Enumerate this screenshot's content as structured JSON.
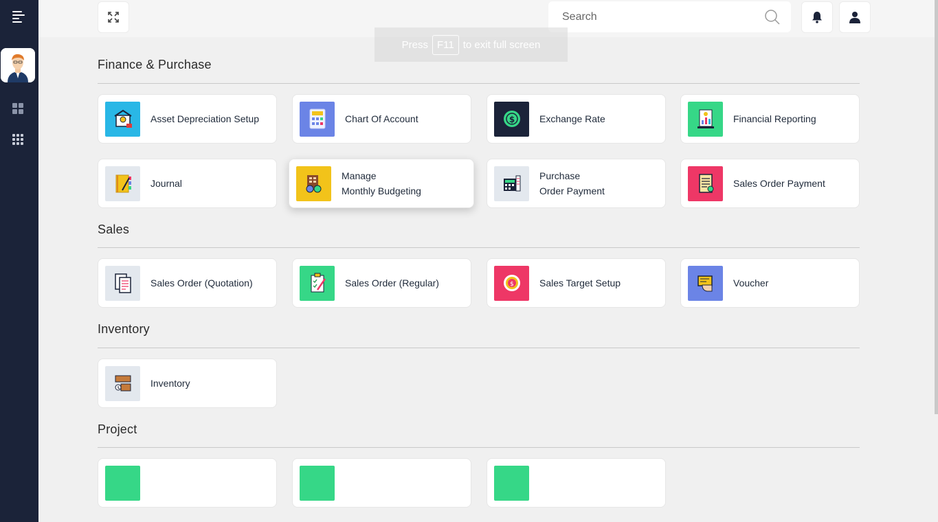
{
  "search": {
    "placeholder": "Search"
  },
  "toast": {
    "pre": "Press",
    "key": "F11",
    "post": "to exit full screen"
  },
  "colors": {
    "sidebar": "#1b2339",
    "green": "#36d787",
    "blue": "#6b84e6",
    "navy": "#1b2339",
    "yellow": "#f2c31a",
    "pink": "#ee3766",
    "sky": "#29b7e6",
    "gray": "#e3e8ee"
  },
  "sections": {
    "finance": {
      "title": "Finance & Purchase",
      "items": [
        {
          "label": "Asset Depreciation Setup",
          "icon": "building-money-icon",
          "color": "#29b7e6"
        },
        {
          "label": "Chart Of Account",
          "icon": "calculator-chart-icon",
          "color": "#6b84e6"
        },
        {
          "label": "Exchange Rate",
          "icon": "currency-exchange-icon",
          "color": "#1b2339"
        },
        {
          "label": "Financial Reporting",
          "icon": "report-chart-icon",
          "color": "#36d787"
        },
        {
          "label": "Journal",
          "icon": "journal-book-icon",
          "color": "#e3e8ee"
        },
        {
          "label_line1": "Manage",
          "label_line2": "Monthly Budgeting",
          "icon": "budget-icon",
          "color": "#f2c31a"
        },
        {
          "label_line1": "Purchase",
          "label_line2": "Order Payment",
          "icon": "purchase-register-icon",
          "color": "#e3e8ee"
        },
        {
          "label": "Sales Order Payment",
          "icon": "invoice-icon",
          "color": "#ee3766"
        }
      ]
    },
    "sales": {
      "title": "Sales",
      "items": [
        {
          "label": "Sales Order (Quotation)",
          "icon": "quotation-doc-icon",
          "color": "#e3e8ee"
        },
        {
          "label": "Sales Order (Regular)",
          "icon": "clipboard-check-icon",
          "color": "#36d787"
        },
        {
          "label": "Sales Target Setup",
          "icon": "target-icon",
          "color": "#ee3766"
        },
        {
          "label": "Voucher",
          "icon": "voucher-hand-icon",
          "color": "#6b84e6"
        }
      ]
    },
    "inventory": {
      "title": "Inventory",
      "items": [
        {
          "label": "Inventory",
          "icon": "inventory-boxes-icon",
          "color": "#e3e8ee"
        }
      ]
    },
    "project": {
      "title": "Project",
      "items": [
        {
          "color": "#36d787"
        },
        {
          "color": "#36d787"
        },
        {
          "color": "#36d787"
        }
      ]
    }
  }
}
